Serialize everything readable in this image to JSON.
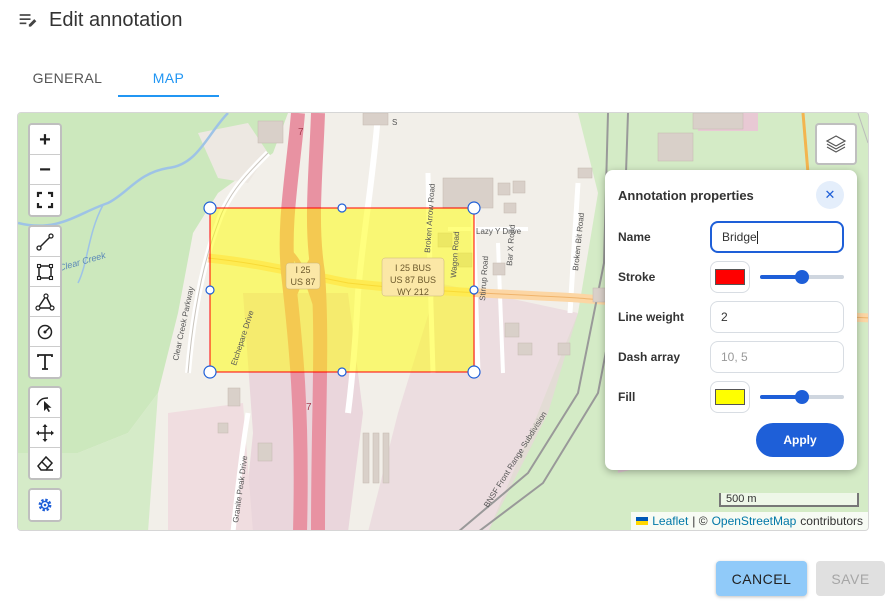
{
  "header": {
    "title": "Edit annotation",
    "icon": "edit-note-icon"
  },
  "tabs": [
    {
      "label": "GENERAL",
      "active": false
    },
    {
      "label": "MAP",
      "active": true
    }
  ],
  "map": {
    "zoom_in": "+",
    "zoom_out": "−",
    "labels": {
      "clear_creek": "Clear Creek",
      "clear_creek_parkway": "Clear Creek Parkway",
      "etchepare_drive": "Etchepare Drive",
      "granite_peak_drive": "Granite Peak Drive",
      "broken_arrow_road": "Broken Arrow Road",
      "wagon_road": "Wagon Road",
      "stirrup_road": "Stirrup Road",
      "lazy_y_drive": "Lazy Y Drive",
      "bar_x_road": "Bar X Road",
      "broken_bit_road": "Broken Bit Road",
      "bnsf": "BNSF Front Range Subdivision",
      "i25_shield_a": "I 25",
      "i25_shield_b": "US 87",
      "bus_line1": "I 25 BUS",
      "bus_line2": "US 87 BUS",
      "bus_line3": "WY 212",
      "route_7_top": "7",
      "route_7_bottom": "7",
      "road_s": "S"
    },
    "scale": "500 m",
    "attribution": {
      "leaflet": "Leaflet",
      "separator": "| ©",
      "osm": "OpenStreetMap",
      "contributors": "contributors"
    }
  },
  "annotation_panel": {
    "title": "Annotation properties",
    "close_symbol": "✕",
    "name_label": "Name",
    "name_value": "Bridge",
    "stroke_label": "Stroke",
    "stroke_color": "#ff0000",
    "stroke_opacity": 0.5,
    "line_weight_label": "Line weight",
    "line_weight_value": "2",
    "dash_array_label": "Dash array",
    "dash_array_placeholder": "10, 5",
    "fill_label": "Fill",
    "fill_color": "#ffff00",
    "fill_opacity": 0.5,
    "apply_label": "Apply"
  },
  "footer": {
    "cancel_label": "CANCEL",
    "save_label": "SAVE"
  },
  "colors": {
    "accent": "#2196f3",
    "primary": "#1e5fd8",
    "highway": "#e892a2",
    "rectangle_fill": "#ffff00",
    "rectangle_stroke": "#ff0000"
  }
}
